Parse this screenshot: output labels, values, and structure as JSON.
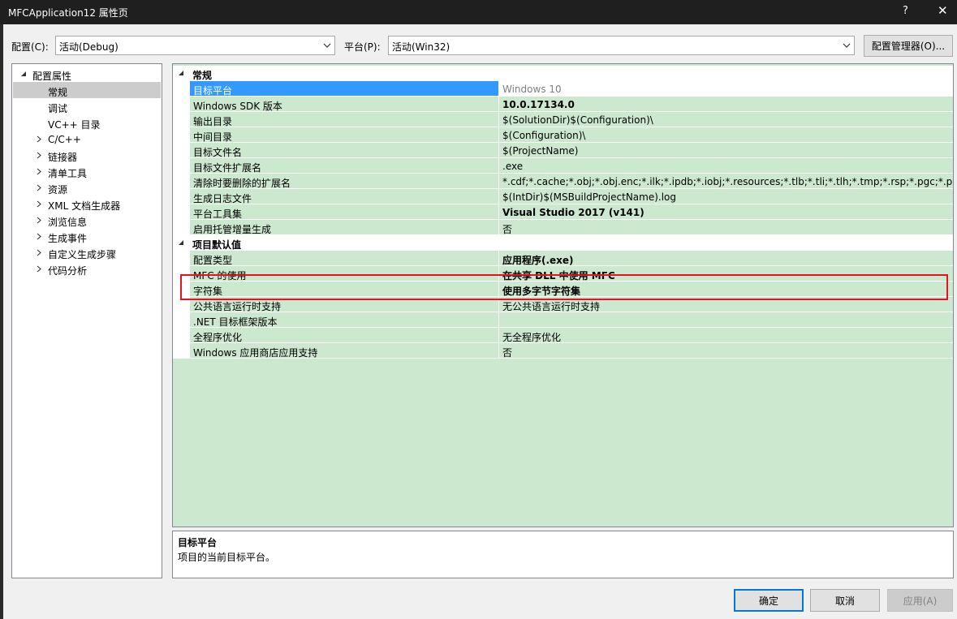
{
  "window": {
    "title": "MFCApplication12 属性页",
    "help": "?",
    "close": "✕"
  },
  "toolbar": {
    "config_label": "配置(C):",
    "config_value": "活动(Debug)",
    "platform_label": "平台(P):",
    "platform_value": "活动(Win32)",
    "config_manager": "配置管理器(O)..."
  },
  "tree": {
    "root": "配置属性",
    "items": [
      "常规",
      "调试",
      "VC++ 目录",
      "C/C++",
      "链接器",
      "清单工具",
      "资源",
      "XML 文档生成器",
      "浏览信息",
      "生成事件",
      "自定义生成步骤",
      "代码分析"
    ],
    "selected": "常规"
  },
  "grid": {
    "sections": [
      {
        "title": "常规",
        "rows": [
          {
            "name": "目标平台",
            "value": "Windows 10",
            "bold": false
          },
          {
            "name": "Windows SDK 版本",
            "value": "10.0.17134.0",
            "bold": true
          },
          {
            "name": "输出目录",
            "value": "$(SolutionDir)$(Configuration)\\",
            "bold": false
          },
          {
            "name": "中间目录",
            "value": "$(Configuration)\\",
            "bold": false
          },
          {
            "name": "目标文件名",
            "value": "$(ProjectName)",
            "bold": false
          },
          {
            "name": "目标文件扩展名",
            "value": ".exe",
            "bold": false
          },
          {
            "name": "清除时要删除的扩展名",
            "value": "*.cdf;*.cache;*.obj;*.obj.enc;*.ilk;*.ipdb;*.iobj;*.resources;*.tlb;*.tli;*.tlh;*.tmp;*.rsp;*.pgc;*.pgd;*.meta",
            "bold": false
          },
          {
            "name": "生成日志文件",
            "value": "$(IntDir)$(MSBuildProjectName).log",
            "bold": false
          },
          {
            "name": "平台工具集",
            "value": "Visual Studio 2017 (v141)",
            "bold": true
          },
          {
            "name": "启用托管增量生成",
            "value": "否",
            "bold": false
          }
        ]
      },
      {
        "title": "项目默认值",
        "rows": [
          {
            "name": "配置类型",
            "value": "应用程序(.exe)",
            "bold": true
          },
          {
            "name": "MFC 的使用",
            "value": "在共享 DLL 中使用 MFC",
            "bold": true
          },
          {
            "name": "字符集",
            "value": "使用多字节字符集",
            "bold": true
          },
          {
            "name": "公共语言运行时支持",
            "value": "无公共语言运行时支持",
            "bold": false
          },
          {
            "name": ".NET 目标框架版本",
            "value": "",
            "bold": false
          },
          {
            "name": "全程序优化",
            "value": "无全程序优化",
            "bold": false
          },
          {
            "name": "Windows 应用商店应用支持",
            "value": "否",
            "bold": false
          }
        ]
      }
    ]
  },
  "description": {
    "title": "目标平台",
    "text": "项目的当前目标平台。"
  },
  "buttons": {
    "ok": "确定",
    "cancel": "取消",
    "apply": "应用(A)"
  },
  "colors": {
    "grid_bg": "#cce8cf",
    "selection": "#3399ff",
    "highlight_box": "#e81123",
    "titlebar": "#1f1f1f"
  }
}
